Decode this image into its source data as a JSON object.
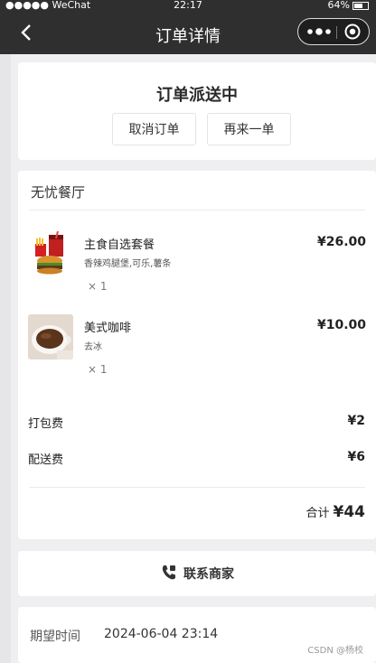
{
  "status_bar": {
    "carrier": "●●●●● WeChat",
    "time": "22:17",
    "battery": "64%"
  },
  "navbar": {
    "title": "订单详情",
    "back_icon": "chevron-left-icon",
    "more_icon": "more-dots-icon",
    "close_icon": "target-close-icon"
  },
  "order_status": {
    "title": "订单派送中",
    "cancel_label": "取消订单",
    "reorder_label": "再来一单"
  },
  "shop": {
    "name": "无忧餐厅"
  },
  "items": [
    {
      "name": "主食自选套餐",
      "desc": "香辣鸡腿堡,可乐,薯条",
      "qty": "× 1",
      "price": "¥26.00",
      "image": "burger-combo"
    },
    {
      "name": "美式咖啡",
      "desc": "去冰",
      "qty": "× 1",
      "price": "¥10.00",
      "image": "coffee-cup"
    }
  ],
  "fees": {
    "packing": {
      "label": "打包费",
      "value": "¥2"
    },
    "delivery": {
      "label": "配送费",
      "value": "¥6"
    }
  },
  "total": {
    "label": "合计",
    "value": "¥44"
  },
  "contact": {
    "label": "联系商家",
    "icon": "phone-icon"
  },
  "expect": {
    "label": "期望时间",
    "value": "2024-06-04 23:14"
  },
  "watermark": "CSDN @杨校",
  "colors": {
    "navbar": "#2f2f2f",
    "background": "#efeff1",
    "card": "#ffffff"
  }
}
